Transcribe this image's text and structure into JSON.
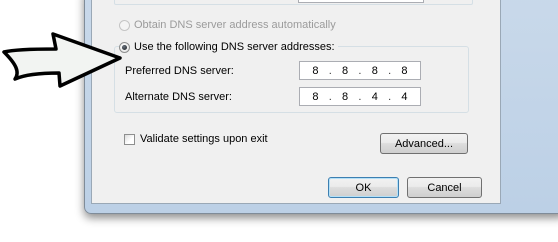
{
  "dns": {
    "auto_option_label": "Obtain DNS server address automatically",
    "manual_option_label": "Use the following DNS server addresses:",
    "preferred_label": "Preferred DNS server:",
    "alternate_label": "Alternate DNS server:",
    "preferred_octets": [
      "8",
      "8",
      "8",
      "8"
    ],
    "alternate_octets": [
      "8",
      "8",
      "4",
      "4"
    ],
    "selected_option": "manual"
  },
  "validate": {
    "label": "Validate settings upon exit",
    "checked": false
  },
  "buttons": {
    "advanced_label": "Advanced...",
    "ok_label": "OK",
    "cancel_label": "Cancel"
  },
  "icons": {
    "pointer": "arrow-pointer-icon"
  },
  "colors": {
    "arrow_fill": "#f2f4f2",
    "arrow_stroke": "#000000",
    "window_frame": "#bcd0e6",
    "dialog_bg": "#f0f0f0"
  }
}
